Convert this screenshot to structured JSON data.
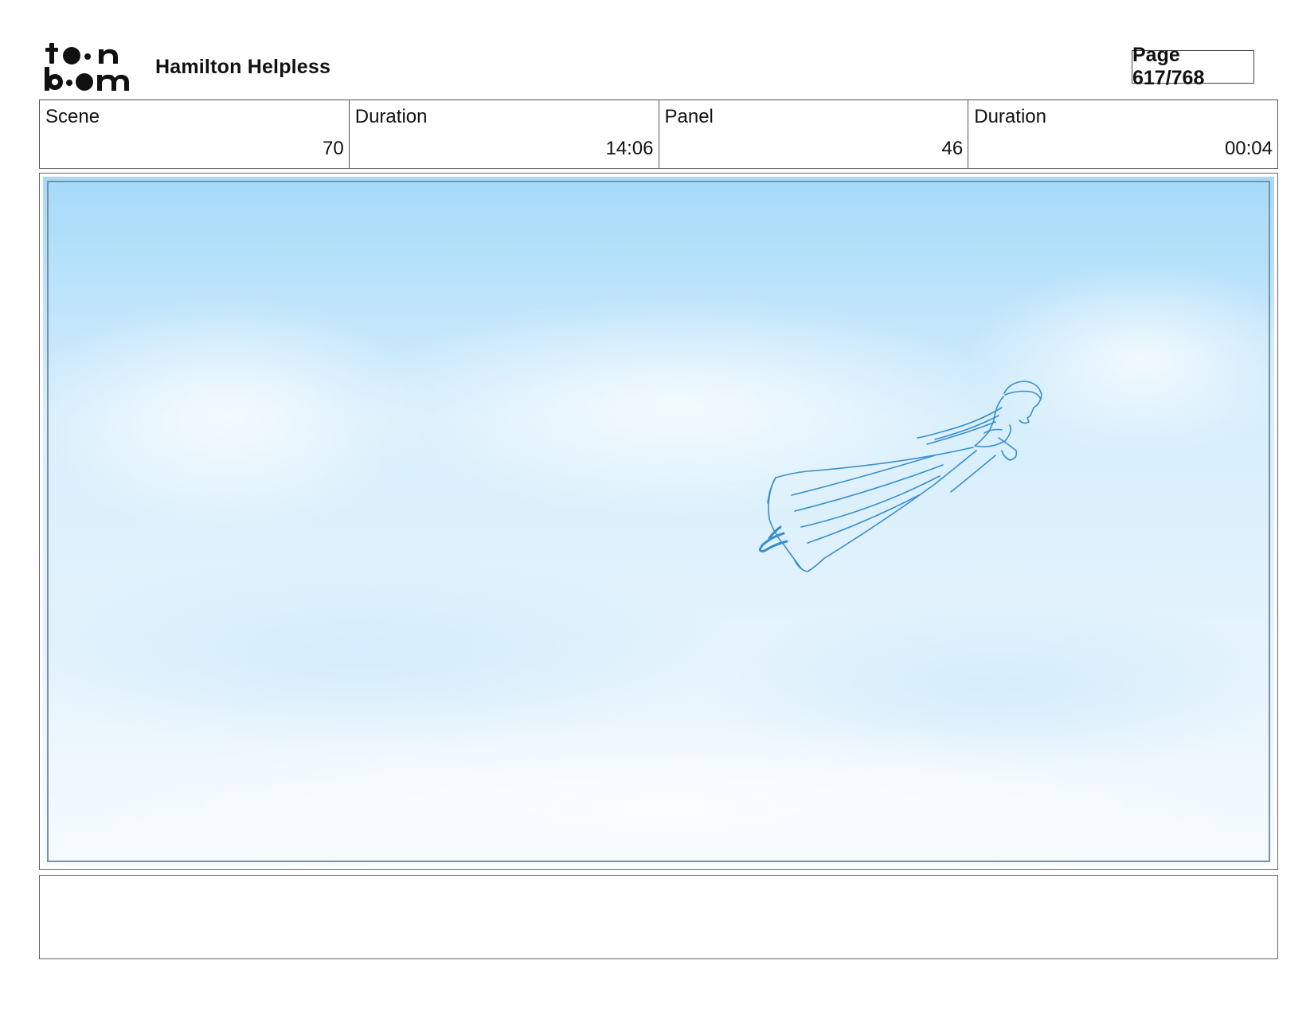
{
  "header": {
    "logo_line1": "toon",
    "logo_line2": "boom",
    "project_title": "Hamilton Helpless",
    "page_label": "Page 617/768"
  },
  "info": {
    "scene_label": "Scene",
    "scene_value": "70",
    "scene_duration_label": "Duration",
    "scene_duration_value": "14:06",
    "panel_label": "Panel",
    "panel_value": "46",
    "panel_duration_label": "Duration",
    "panel_duration_value": "00:04"
  },
  "panel": {
    "sky_top_color": "#a7dbfa",
    "sky_bottom_color": "#f4fafe",
    "sketch_color": "#3a8fce",
    "frame_line_color": "#7d8fa0"
  },
  "notes": {}
}
